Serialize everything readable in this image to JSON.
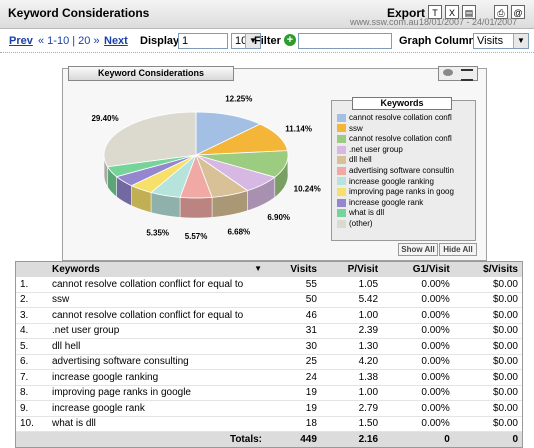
{
  "header": {
    "title": "Keyword Considerations",
    "export_label": "Export",
    "site": "www.ssw.com.au",
    "date_range": "18/01/2007 - 24/01/2007"
  },
  "toolbar": {
    "prev": "Prev",
    "page_info": "« 1-10 | 20 »",
    "next": "Next",
    "display_label": "Display",
    "display_page": "1",
    "display_count": "10",
    "filter_label": "Filter",
    "filter_value": "",
    "graph_label": "Graph Column",
    "graph_value": "Visits"
  },
  "chart_panel": {
    "title": "Keyword Considerations"
  },
  "chart_data": {
    "type": "pie",
    "slices": [
      {
        "label": "cannot resolve collation confl",
        "value": 12.25,
        "color": "#a3bfe3"
      },
      {
        "label": "ssw",
        "value": 11.14,
        "color": "#f3b638"
      },
      {
        "label": "cannot resolve collation confl",
        "value": 10.24,
        "color": "#9ccc80"
      },
      {
        "label": ".net user group",
        "value": 6.9,
        "color": "#d7b8e3"
      },
      {
        "label": "dll hell",
        "value": 6.68,
        "color": "#d9c197"
      },
      {
        "label": "advertising software consultin",
        "value": 5.57,
        "color": "#f1a9a5"
      },
      {
        "label": "increase google ranking",
        "value": 5.35,
        "color": "#b6e3db"
      },
      {
        "label": "improving page ranks in goog",
        "value": 4.23,
        "color": "#f6e06a"
      },
      {
        "label": "increase google rank",
        "value": 4.23,
        "color": "#9486cf"
      },
      {
        "label": "what is dll",
        "value": 4.01,
        "color": "#76d49b"
      },
      {
        "label": "(other)",
        "value": 29.4,
        "color": "#dcd9cf"
      }
    ],
    "labels_shown": [
      "12.25%",
      "11.14%",
      "10.24%",
      "6.90%",
      "6.68%",
      "5.57%",
      "5.35%",
      "29.40%"
    ]
  },
  "legend": {
    "title": "Keywords",
    "show_all": "Show All",
    "hide_all": "Hide All"
  },
  "table": {
    "headers": [
      "Keywords",
      "Visits",
      "P/Visit",
      "G1/Visit",
      "$/Visits"
    ],
    "rows": [
      [
        "1.",
        "cannot resolve collation conflict for equal to",
        "55",
        "1.05",
        "0.00%",
        "$0.00"
      ],
      [
        "2.",
        "ssw",
        "50",
        "5.42",
        "0.00%",
        "$0.00"
      ],
      [
        "3.",
        "cannot resolve collation conflict for equal to",
        "46",
        "1.00",
        "0.00%",
        "$0.00"
      ],
      [
        "4.",
        ".net user group",
        "31",
        "2.39",
        "0.00%",
        "$0.00"
      ],
      [
        "5.",
        "dll hell",
        "30",
        "1.30",
        "0.00%",
        "$0.00"
      ],
      [
        "6.",
        "advertising software consulting",
        "25",
        "4.20",
        "0.00%",
        "$0.00"
      ],
      [
        "7.",
        "increase google ranking",
        "24",
        "1.38",
        "0.00%",
        "$0.00"
      ],
      [
        "8.",
        "improving page ranks in google",
        "19",
        "1.00",
        "0.00%",
        "$0.00"
      ],
      [
        "9.",
        "increase google rank",
        "19",
        "2.79",
        "0.00%",
        "$0.00"
      ],
      [
        "10.",
        "what is dll",
        "18",
        "1.50",
        "0.00%",
        "$0.00"
      ]
    ],
    "totals": {
      "label": "Totals:",
      "visits": "449",
      "pvisit": "2.16",
      "g1": "0",
      "dollar": "0"
    }
  }
}
